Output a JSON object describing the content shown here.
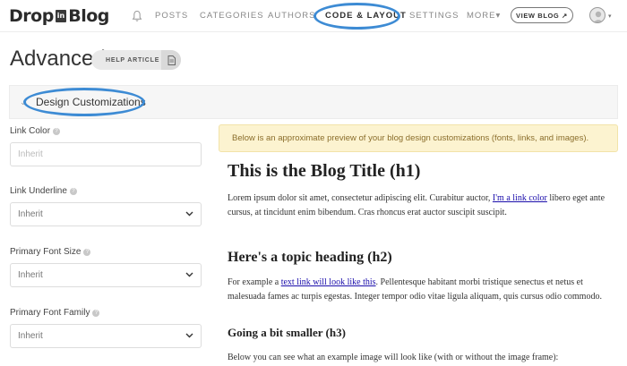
{
  "nav": {
    "logo_left": "Drop",
    "logo_mid": "in",
    "logo_right": "Blog",
    "items": [
      {
        "label": "POSTS"
      },
      {
        "label": "CATEGORIES"
      },
      {
        "label": "AUTHORS"
      },
      {
        "label": "CODE & LAYOUT"
      },
      {
        "label": "SETTINGS"
      },
      {
        "label": "MORE▾"
      }
    ],
    "view_blog": "VIEW BLOG ↗",
    "active_item": "CODE & LAYOUT",
    "highlight_color": "#3d8bd4"
  },
  "header": {
    "title": "Advanced",
    "help_button": "HELP ARTICLE"
  },
  "section": {
    "title": "Design Customizations"
  },
  "form": {
    "link_color": {
      "label": "Link Color",
      "placeholder": "Inherit"
    },
    "link_underline": {
      "label": "Link Underline",
      "value": "Inherit"
    },
    "primary_font_size": {
      "label": "Primary Font Size",
      "value": "Inherit"
    },
    "primary_font_family": {
      "label": "Primary Font Family",
      "value": "Inherit"
    }
  },
  "preview": {
    "notice": "Below is an approximate preview of your blog design customizations (fonts, links, and images).",
    "h1": "This is the Blog Title (h1)",
    "p1_a": "Lorem ipsum dolor sit amet, consectetur adipiscing elit. Curabitur auctor, ",
    "p1_link": "I'm a link color",
    "p1_b": " libero eget ante cursus, at tincidunt enim bibendum. Cras rhoncus erat auctor suscipit suscipit.",
    "h2": "Here's a topic heading (h2)",
    "p2_a": "For example a ",
    "p2_link": "text link will look like this",
    "p2_b": ". Pellentesque habitant morbi tristique senectus et netus et malesuada fames ac turpis egestas. Integer tempor odio vitae ligula aliquam, quis cursus odio commodo.",
    "h3": "Going a bit smaller (h3)",
    "p3": "Below you can see what an example image will look like (with or without the image frame):"
  }
}
